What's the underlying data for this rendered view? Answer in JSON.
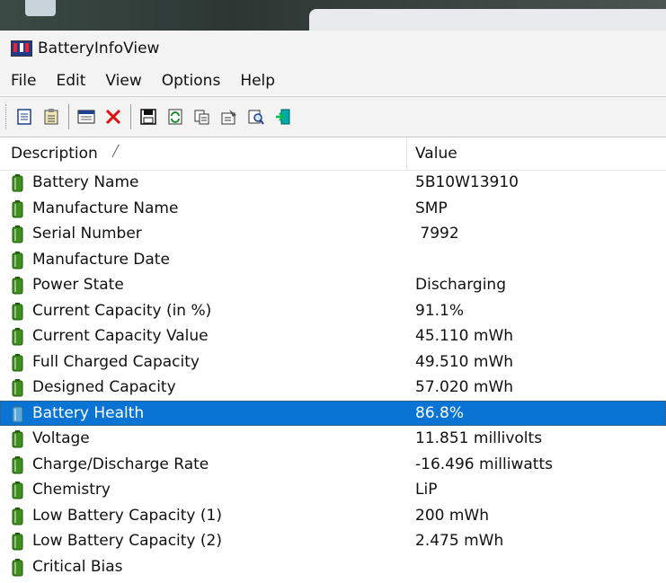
{
  "window": {
    "title": "BatteryInfoView"
  },
  "menu": [
    "File",
    "Edit",
    "View",
    "Options",
    "Help"
  ],
  "toolbar": {
    "buttons": [
      "properties-view-icon",
      "clipboard-list-icon",
      "window-icon",
      "delete-icon",
      "save-icon",
      "refresh-icon",
      "copy-icon",
      "properties-icon",
      "find-icon",
      "exit-icon"
    ]
  },
  "table": {
    "columns": {
      "description": "Description",
      "value": "Value"
    },
    "rows": [
      {
        "description": "Battery Name",
        "value": "5B10W13910"
      },
      {
        "description": "Manufacture Name",
        "value": "SMP"
      },
      {
        "description": "Serial Number",
        "value": " 7992"
      },
      {
        "description": "Manufacture Date",
        "value": ""
      },
      {
        "description": "Power State",
        "value": "Discharging"
      },
      {
        "description": "Current Capacity (in %)",
        "value": "91.1%"
      },
      {
        "description": "Current Capacity Value",
        "value": "45.110 mWh"
      },
      {
        "description": "Full Charged Capacity",
        "value": "49.510 mWh"
      },
      {
        "description": "Designed Capacity",
        "value": "57.020 mWh"
      },
      {
        "description": "Battery Health",
        "value": "86.8%",
        "selected": true
      },
      {
        "description": "Voltage",
        "value": "11.851 millivolts"
      },
      {
        "description": "Charge/Discharge Rate",
        "value": "-16.496 milliwatts"
      },
      {
        "description": "Chemistry",
        "value": "LiP"
      },
      {
        "description": "Low Battery Capacity (1)",
        "value": "200 mWh"
      },
      {
        "description": "Low Battery Capacity (2)",
        "value": "2.475 mWh"
      },
      {
        "description": "Critical Bias",
        "value": ""
      }
    ]
  },
  "colors": {
    "selection": "#0a74d4",
    "battery": "#3f8f1f"
  }
}
